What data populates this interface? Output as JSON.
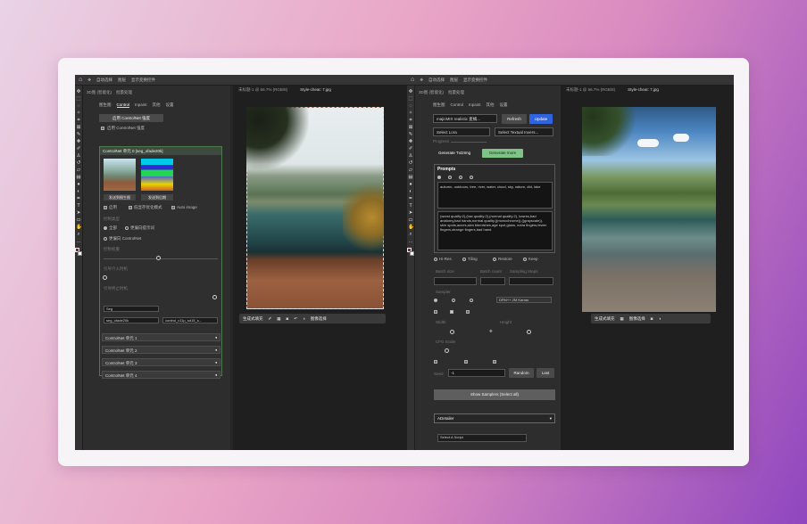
{
  "left_window": {
    "menubar": [
      "ps-home",
      "move-tool",
      "自动选择",
      "图层",
      "显示变换控件"
    ],
    "tabs_top": [
      "3D图 (智能化)",
      "批量处理"
    ],
    "panel_tabs": [
      "图生图",
      "Control",
      "Inpaint",
      "其他",
      "设置"
    ],
    "enable_label": "启用 ControlNet 强度",
    "unit_title": "ControlNet 单元 0 [seg_ofade20k]",
    "thumb_btn_1": "发送到图生图",
    "thumb_btn_2": "发送到后期",
    "opt_enable": "启用",
    "opt_lowvram": "低显存优化模式",
    "opt_pixel": "Pixel Perfect",
    "opt_auto": "Auto image",
    "control_type_label": "控制类型",
    "radio_all": "全部",
    "radio_balanced": "均衡",
    "radio_more": "更偏向提示词",
    "radio_cn": "更偏向 ControlNet",
    "label_weight": "控制权重",
    "label_start": "引导介入时机",
    "label_end": "引导终止时机",
    "preprocessor": "Seg",
    "model_select": "seg_ofade20k",
    "model_select_2": "control_v11p_sd15_s...",
    "units": [
      "ControlNet 单元 1",
      "ControlNet 单元 2",
      "ControlNet 单元 3",
      "ControlNet 单元 4"
    ],
    "doc_tab": "未标题-1 @ 66.7% (RGB/8)",
    "doc_tab_b": "Style-cheat: 7.jpg",
    "dock_labels": [
      "生成式填充",
      "图像选择"
    ]
  },
  "right_window": {
    "menubar": [
      "ps-home",
      "move-tool",
      "自动选择",
      "图层",
      "显示变换控件"
    ],
    "tabs_top": [
      "3D图 (智能化)",
      "批量处理"
    ],
    "panel_tabs": [
      "图生图",
      "Control",
      "Inpaint",
      "其他",
      "设置"
    ],
    "checkpoint": "majicMIX realistic 麦橘...",
    "btn_refresh": "Refresh",
    "btn_update": "Update",
    "lora": "Select Lora",
    "textual_inversion": "Select Textual Invers...",
    "progress_label": "Progress",
    "btn_generate": "Generate Txt2Img",
    "btn_generate_more": "Generate more",
    "prompts_label": "Prompts",
    "prompt_text": "autumn, outdoors, tree, river, water, cloud, sky, nature, dtd, lake",
    "negative_text": "(worst quality:2),(low quality:2),(normal quality:2), lowres,bad anatomy,bad hands,normal quality,((monochrome)),((grayscale)), skin spots,acnes,skin blemishes,age spot,glans, extra fingers,fewer fingers,strange fingers,bad hand",
    "opt_hires": "Hi-Res",
    "opt_tiling": "Tiling",
    "opt_restore": "Restore",
    "opt_keepsize": "Keep",
    "label_batch": "Batch size",
    "label_count": "Batch count",
    "label_steps": "Sampling Steps",
    "label_sampler": "Sampler",
    "sampler_value": "DPM++ 2M Karras",
    "label_width": "Width",
    "label_height": "Height",
    "label_cfg": "CFG Scale",
    "seed_label": "Seed",
    "seed_value": "-1",
    "btn_random": "Random",
    "btn_last": "Last",
    "btn_show_samplers": "Show Samplers (Select all)",
    "adetailer": "ADetailer",
    "adetailer_model": "Select A Script",
    "doc_tab": "未标题-1 @ 66.7% (RGB/8)",
    "doc_tab_b": "Style-cheat: 7.jpg",
    "dock_labels": [
      "生成式填充",
      "图像选择"
    ]
  },
  "colors": {
    "foreground": "#a3123a",
    "background": "#ffffff",
    "accent_blue": "#2f63e0",
    "accent_green": "#7ec484"
  }
}
